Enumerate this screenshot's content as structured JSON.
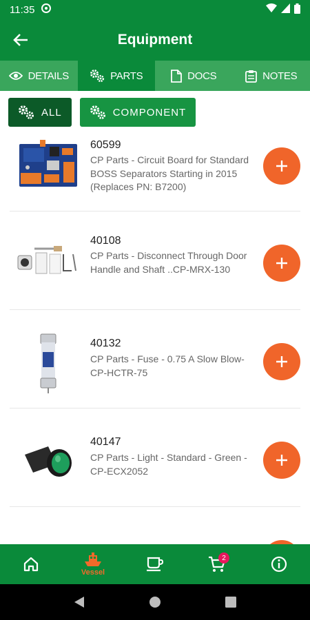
{
  "status_bar": {
    "time": "11:35"
  },
  "app_bar": {
    "title": "Equipment"
  },
  "tabs": [
    {
      "label": "DETAILS",
      "icon": "eye-icon"
    },
    {
      "label": "PARTS",
      "icon": "gears-icon",
      "active": true
    },
    {
      "label": "DOCS",
      "icon": "document-icon"
    },
    {
      "label": "NOTES",
      "icon": "clipboard-icon"
    }
  ],
  "filters": [
    {
      "label": "ALL",
      "icon": "gears-icon",
      "selected": true
    },
    {
      "label": "COMPONENT",
      "icon": "gears-icon"
    }
  ],
  "parts": [
    {
      "number": "60599",
      "description": "CP Parts - Circuit Board for Standard BOSS Separators Starting in 2015 (Replaces PN: B7200)",
      "image": "circuit-board"
    },
    {
      "number": "40108",
      "description": "CP Parts - Disconnect Through Door Handle and Shaft ..CP-MRX-130",
      "image": "door-handle"
    },
    {
      "number": "40132",
      "description": "CP Parts - Fuse - 0.75 A Slow Blow-CP-HCTR-75",
      "image": "fuse"
    },
    {
      "number": "40147",
      "description": "CP Parts - Light - Standard - Green - CP-ECX2052",
      "image": "green-light"
    }
  ],
  "bottom_nav": {
    "items": [
      {
        "name": "home",
        "icon": "home-icon"
      },
      {
        "name": "vessel",
        "icon": "vessel-icon",
        "label": "Vessel",
        "active": true
      },
      {
        "name": "coffee",
        "icon": "coffee-icon"
      },
      {
        "name": "cart",
        "icon": "cart-icon",
        "badge": "2"
      },
      {
        "name": "info",
        "icon": "info-icon"
      }
    ]
  },
  "colors": {
    "primary": "#0a8a3a",
    "tab_bar": "#3aa65c",
    "accent": "#f0652a",
    "badge": "#e8175d"
  }
}
